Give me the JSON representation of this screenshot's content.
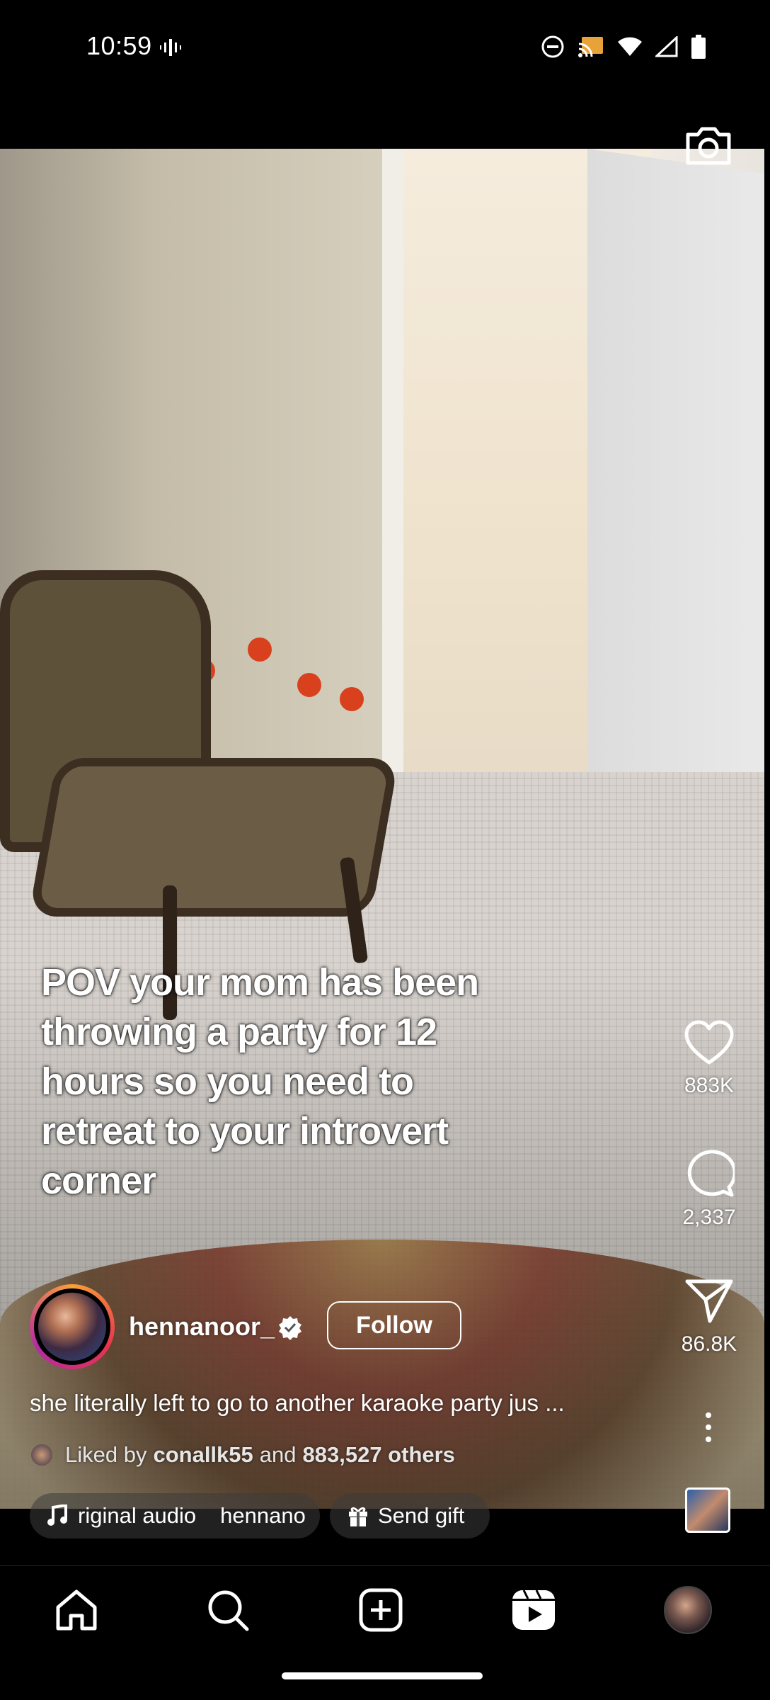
{
  "status_bar": {
    "time": "10:59",
    "icons": [
      "vibrate-icon",
      "do-not-disturb-icon",
      "cast-icon",
      "wifi-icon",
      "signal-icon",
      "battery-icon"
    ]
  },
  "reel": {
    "overlay_caption": "POV your mom has been throwing a party for 12 hours so you need to retreat to your introvert corner",
    "actions": {
      "likes": "883K",
      "comments": "2,337",
      "shares": "86.8K"
    },
    "author": {
      "username": "hennanoor_",
      "verified": true,
      "follow_label": "Follow"
    },
    "caption": "she literally left to go to another karaoke party jus ...",
    "liked_by": {
      "prefix": "Liked by",
      "user": "conallk55",
      "and": "and",
      "others": "883,527 others"
    },
    "audio": {
      "title": "riginal audio",
      "artist": "hennano"
    },
    "gift_label": "Send gift"
  },
  "nav": {
    "items": [
      "home-icon",
      "search-icon",
      "create-icon",
      "reels-icon",
      "profile-avatar"
    ]
  },
  "colors": {
    "background": "#000000",
    "text": "#ffffff"
  }
}
